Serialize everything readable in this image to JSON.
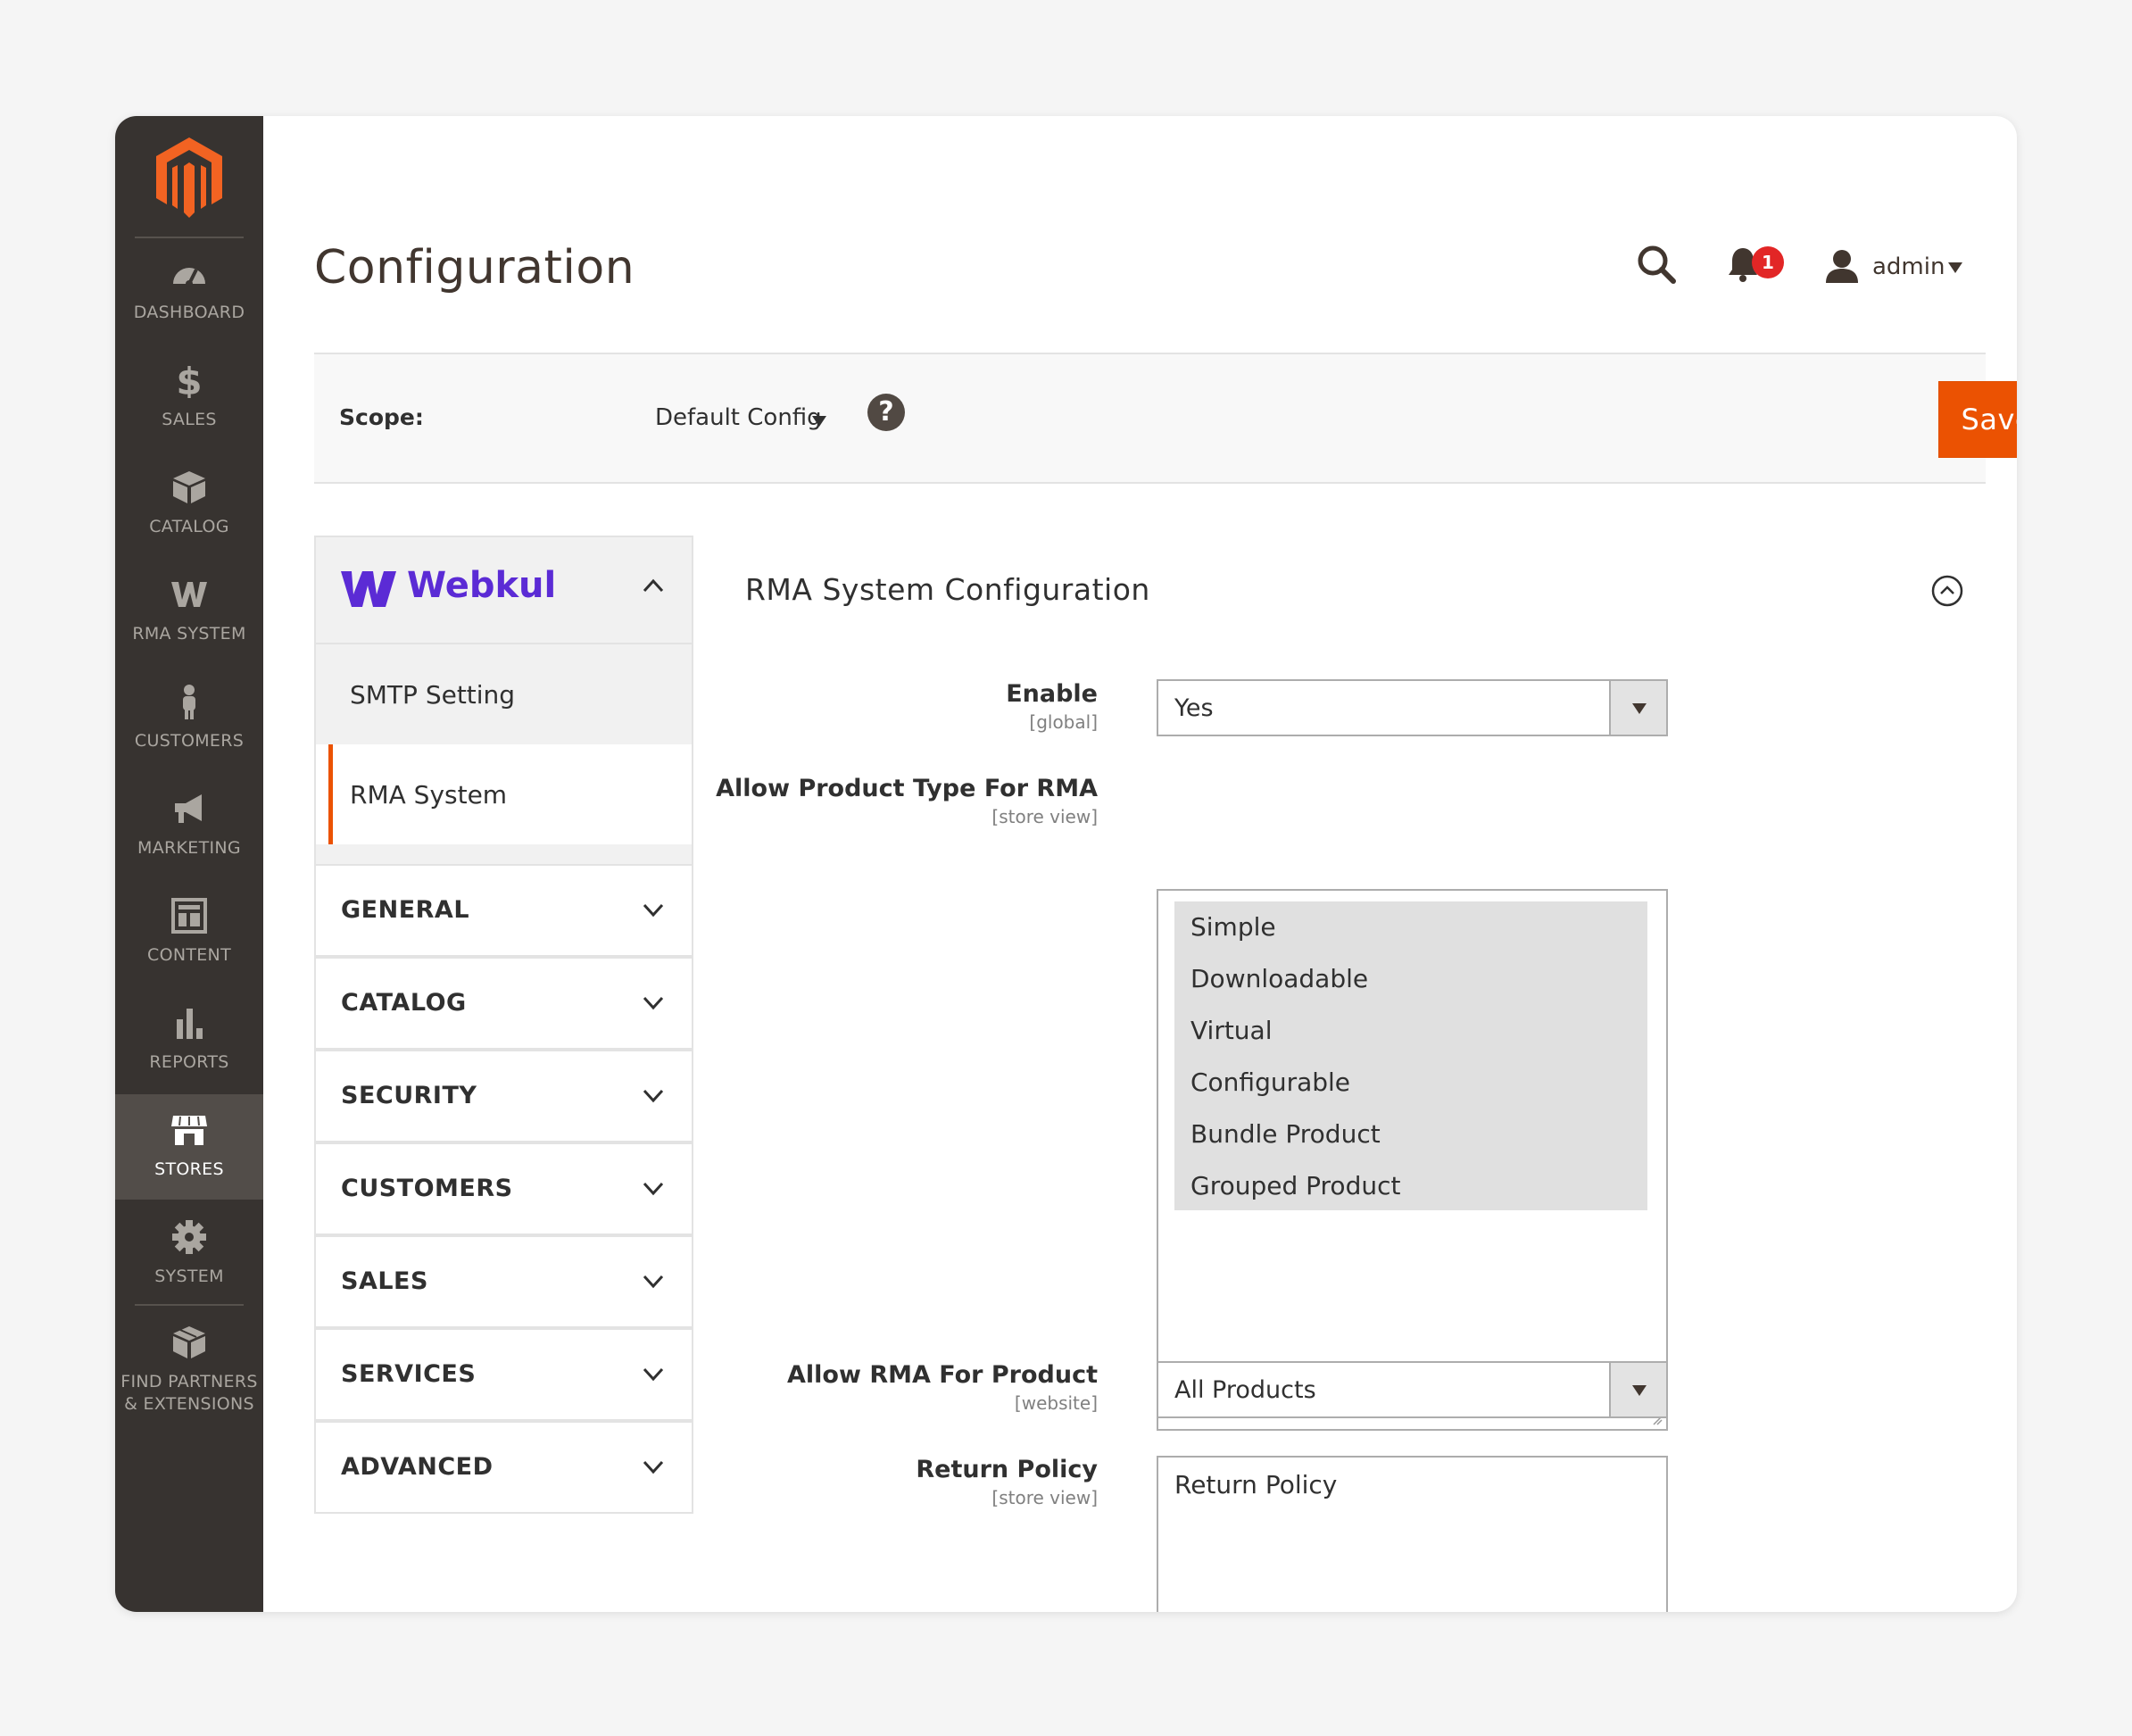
{
  "nav": {
    "items": [
      {
        "label": "DASHBOARD",
        "icon": "dashboard-icon"
      },
      {
        "label": "SALES",
        "icon": "dollar-icon"
      },
      {
        "label": "CATALOG",
        "icon": "box-icon"
      },
      {
        "label": "RMA SYSTEM",
        "icon": "webkul-icon"
      },
      {
        "label": "CUSTOMERS",
        "icon": "person-icon"
      },
      {
        "label": "MARKETING",
        "icon": "megaphone-icon"
      },
      {
        "label": "CONTENT",
        "icon": "layout-icon"
      },
      {
        "label": "REPORTS",
        "icon": "bar-chart-icon"
      },
      {
        "label": "STORES",
        "icon": "store-icon"
      },
      {
        "label": "SYSTEM",
        "icon": "gear-icon"
      },
      {
        "label_line1": "FIND PARTNERS",
        "label_line2": "& EXTENSIONS",
        "icon": "cubes-icon"
      }
    ],
    "active": "STORES"
  },
  "header": {
    "title": "Configuration",
    "notifications_count": "1",
    "user": "admin"
  },
  "scope": {
    "label": "Scope:",
    "value": "Default Config",
    "help": "?",
    "save_label": "Save Config"
  },
  "tabs": {
    "brand": "Webkul",
    "sub_items": [
      {
        "label": "SMTP Setting",
        "active": false
      },
      {
        "label": "RMA System",
        "active": true
      }
    ],
    "sections": [
      "GENERAL",
      "CATALOG",
      "SECURITY",
      "CUSTOMERS",
      "SALES",
      "SERVICES",
      "ADVANCED"
    ]
  },
  "form": {
    "section_title": "RMA System Configuration",
    "fields": {
      "enable": {
        "label": "Enable",
        "scope": "[global]",
        "value": "Yes"
      },
      "product_type": {
        "label": "Allow Product Type For RMA",
        "scope": "[store view]",
        "options": [
          "Simple",
          "Downloadable",
          "Virtual",
          "Configurable",
          "Bundle Product",
          "Grouped Product"
        ]
      },
      "rma_for_product": {
        "label": "Allow RMA For Product",
        "scope": "[website]",
        "value": "All Products"
      },
      "return_policy": {
        "label": "Return Policy",
        "scope": "[store view]",
        "value": "Return Policy"
      }
    }
  },
  "colors": {
    "nav_bg": "#373330",
    "nav_active": "#524d49",
    "accent": "#eb5202",
    "brand": "#5b2bd5",
    "badge": "#e22626"
  }
}
